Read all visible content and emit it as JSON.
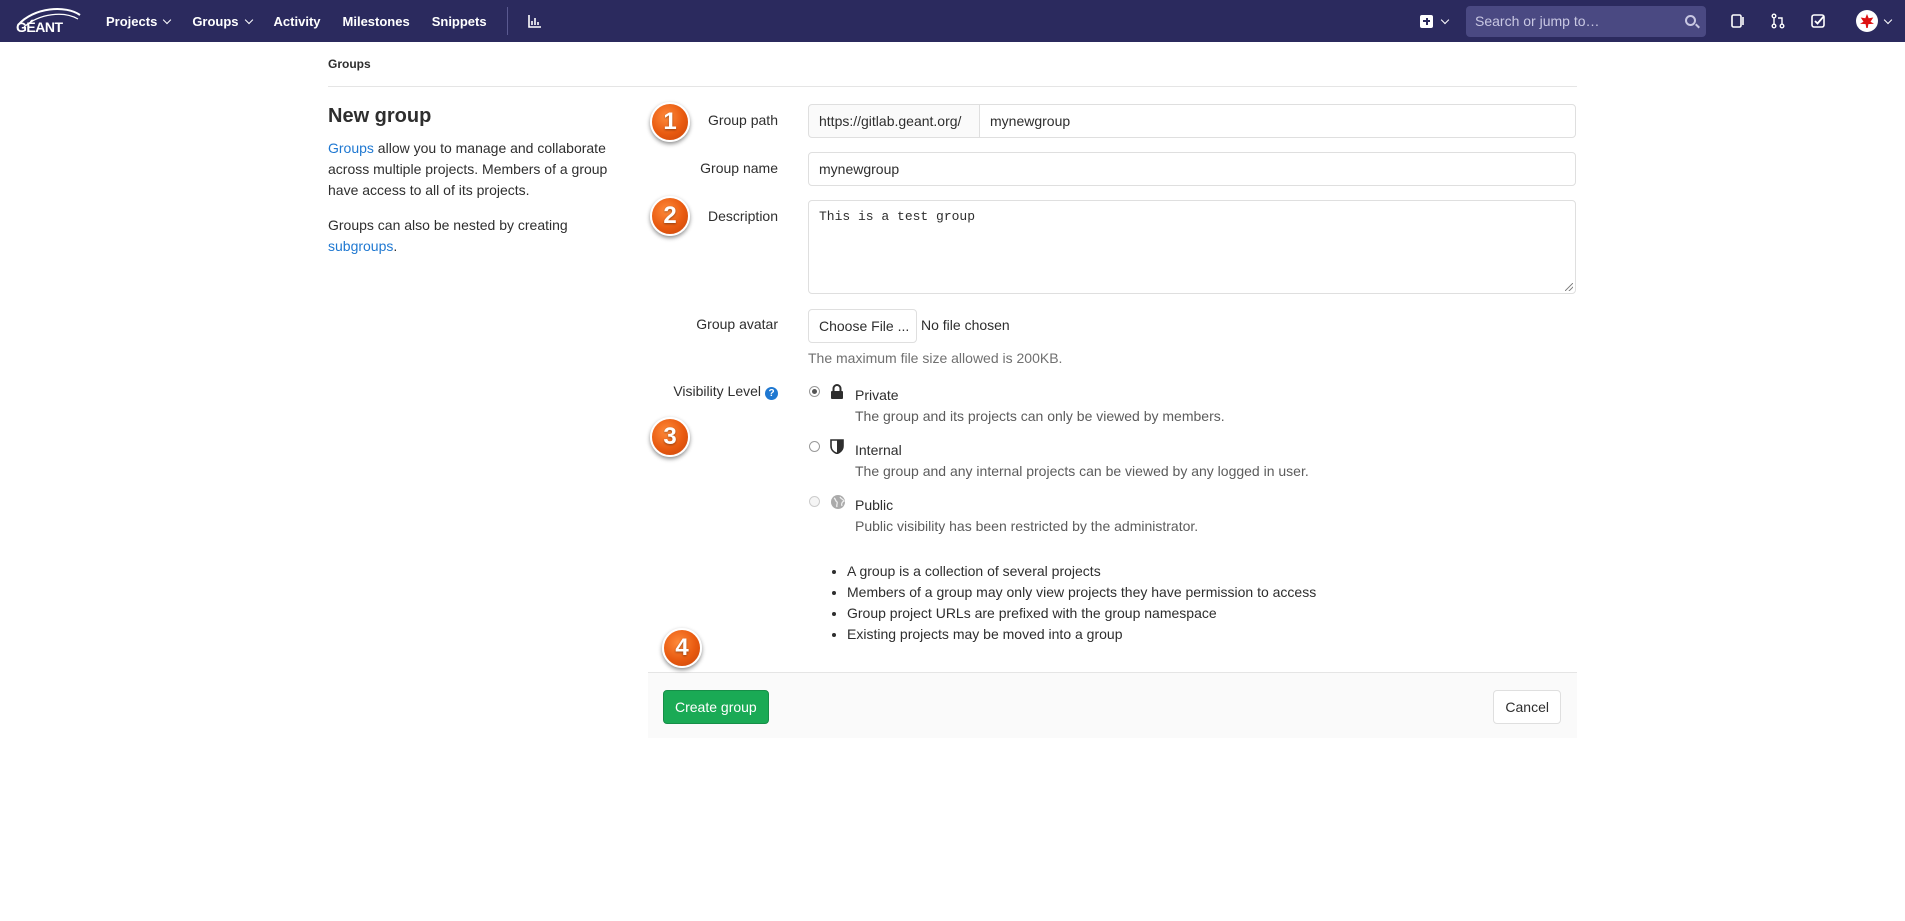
{
  "navbar": {
    "logo_text": "GÉANT",
    "links": [
      {
        "label": "Projects",
        "dropdown": true
      },
      {
        "label": "Groups",
        "dropdown": true
      },
      {
        "label": "Activity",
        "dropdown": false
      },
      {
        "label": "Milestones",
        "dropdown": false
      },
      {
        "label": "Snippets",
        "dropdown": false
      }
    ],
    "search_placeholder": "Search or jump to…",
    "bg_color": "#2b2a5e"
  },
  "breadcrumb": "Groups",
  "intro": {
    "title": "New group",
    "p1_link": "Groups",
    "p1_text": " allow you to manage and collaborate across multiple projects. Members of a group have access to all of its projects.",
    "p2_text": "Groups can also be nested by creating ",
    "p2_link": "subgroups",
    "p2_end": "."
  },
  "form": {
    "path_label": "Group path",
    "path_prefix": "https://gitlab.geant.org/",
    "path_value": "mynewgroup",
    "name_label": "Group name",
    "name_value": "mynewgroup",
    "description_label": "Description",
    "description_value": "This is a test group",
    "avatar_label": "Group avatar",
    "avatar_button": "Choose File ...",
    "avatar_status": "No file chosen",
    "avatar_hint": "The maximum file size allowed is 200KB.",
    "visibility_label": "Visibility Level",
    "help_glyph": "?",
    "visibility_options": [
      {
        "title": "Private",
        "desc": "The group and its projects can only be viewed by members.",
        "icon": "lock-icon",
        "checked": true,
        "disabled": false
      },
      {
        "title": "Internal",
        "desc": "The group and any internal projects can be viewed by any logged in user.",
        "icon": "shield-icon",
        "checked": false,
        "disabled": false
      },
      {
        "title": "Public",
        "desc": "Public visibility has been restricted by the administrator.",
        "icon": "globe-icon",
        "checked": false,
        "disabled": true
      }
    ],
    "bullets": [
      "A group is a collection of several projects",
      "Members of a group may only view projects they have permission to access",
      "Group project URLs are prefixed with the group namespace",
      "Existing projects may be moved into a group"
    ]
  },
  "actions": {
    "create": "Create group",
    "cancel": "Cancel",
    "create_color": "#1aaa55"
  },
  "badges": [
    "1",
    "2",
    "3",
    "4"
  ]
}
